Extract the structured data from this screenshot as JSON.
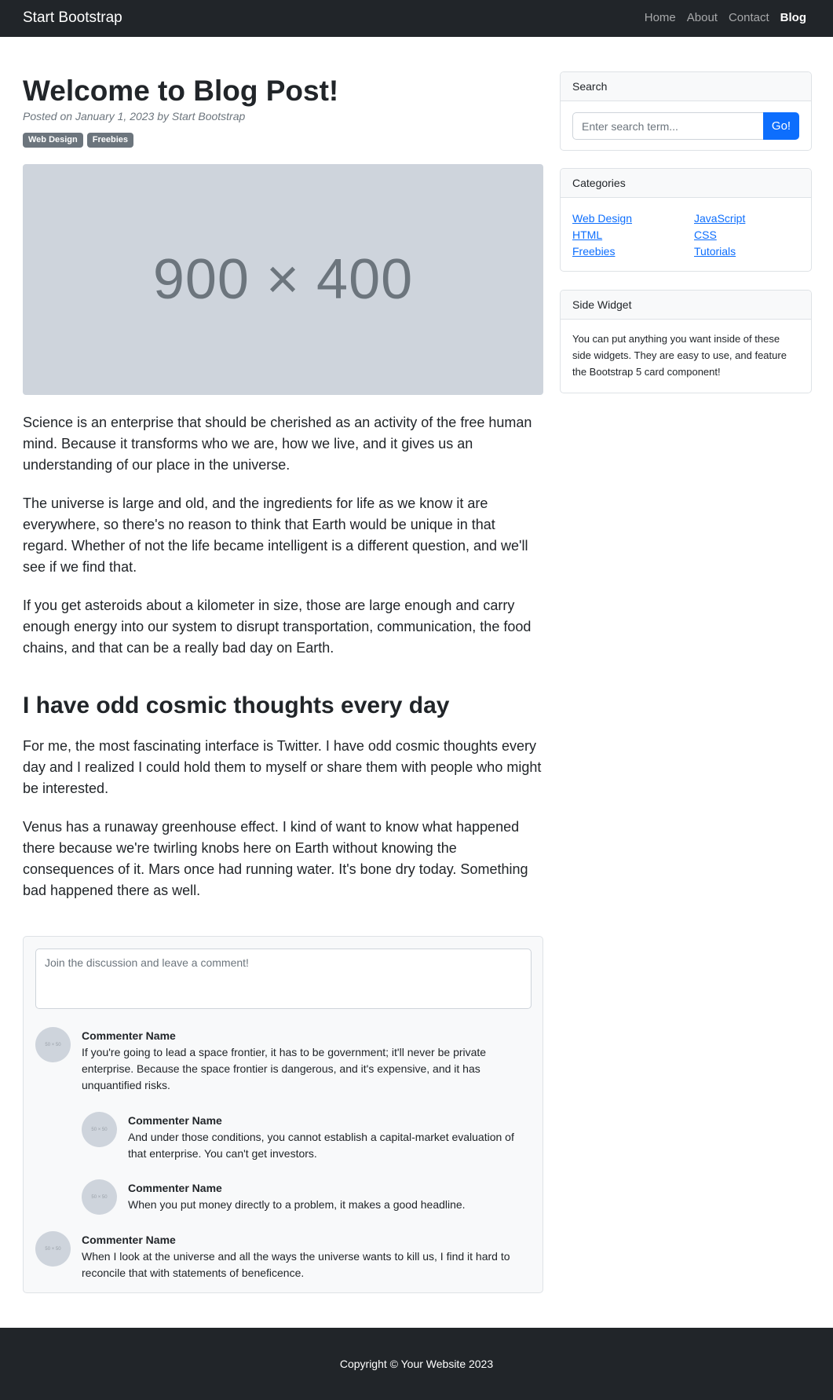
{
  "navbar": {
    "brand": "Start Bootstrap",
    "links": [
      {
        "label": "Home"
      },
      {
        "label": "About"
      },
      {
        "label": "Contact"
      },
      {
        "label": "Blog",
        "active": true
      }
    ]
  },
  "post": {
    "title": "Welcome to Blog Post!",
    "meta": "Posted on January 1, 2023 by Start Bootstrap",
    "badges": [
      "Web Design",
      "Freebies"
    ],
    "hero_placeholder": "900 × 400",
    "paragraphs": [
      "Science is an enterprise that should be cherished as an activity of the free human mind. Because it transforms who we are, how we live, and it gives us an understanding of our place in the universe.",
      "The universe is large and old, and the ingredients for life as we know it are everywhere, so there's no reason to think that Earth would be unique in that regard. Whether of not the life became intelligent is a different question, and we'll see if we find that.",
      "If you get asteroids about a kilometer in size, those are large enough and carry enough energy into our system to disrupt transportation, communication, the food chains, and that can be a really bad day on Earth."
    ],
    "section_heading": "I have odd cosmic thoughts every day",
    "section_paragraphs": [
      "For me, the most fascinating interface is Twitter. I have odd cosmic thoughts every day and I realized I could hold them to myself or share them with people who might be interested.",
      "Venus has a runaway greenhouse effect. I kind of want to know what happened there because we're twirling knobs here on Earth without knowing the consequences of it. Mars once had running water. It's bone dry today. Something bad happened there as well."
    ]
  },
  "comments": {
    "placeholder": "Join the discussion and leave a comment!",
    "avatar_text": "50 × 50",
    "items": [
      {
        "name": "Commenter Name",
        "text": "If you're going to lead a space frontier, it has to be government; it'll never be private enterprise. Because the space frontier is dangerous, and it's expensive, and it has unquantified risks."
      },
      {
        "name": "Commenter Name",
        "text": "And under those conditions, you cannot establish a capital-market evaluation of that enterprise. You can't get investors."
      },
      {
        "name": "Commenter Name",
        "text": "When you put money directly to a problem, it makes a good headline."
      },
      {
        "name": "Commenter Name",
        "text": "When I look at the universe and all the ways the universe wants to kill us, I find it hard to reconcile that with statements of beneficence."
      }
    ]
  },
  "sidebar": {
    "search": {
      "header": "Search",
      "placeholder": "Enter search term...",
      "button": "Go!"
    },
    "categories": {
      "header": "Categories",
      "items": [
        "Web Design",
        "JavaScript",
        "HTML",
        "CSS",
        "Freebies",
        "Tutorials"
      ]
    },
    "widget": {
      "header": "Side Widget",
      "text": "You can put anything you want inside of these side widgets. They are easy to use, and feature the Bootstrap 5 card component!"
    }
  },
  "footer": {
    "copyright": "Copyright © Your Website 2023"
  },
  "colors": {
    "navbar_bg": "#212529",
    "primary": "#0d6efd",
    "badge_bg": "#6c757d"
  }
}
